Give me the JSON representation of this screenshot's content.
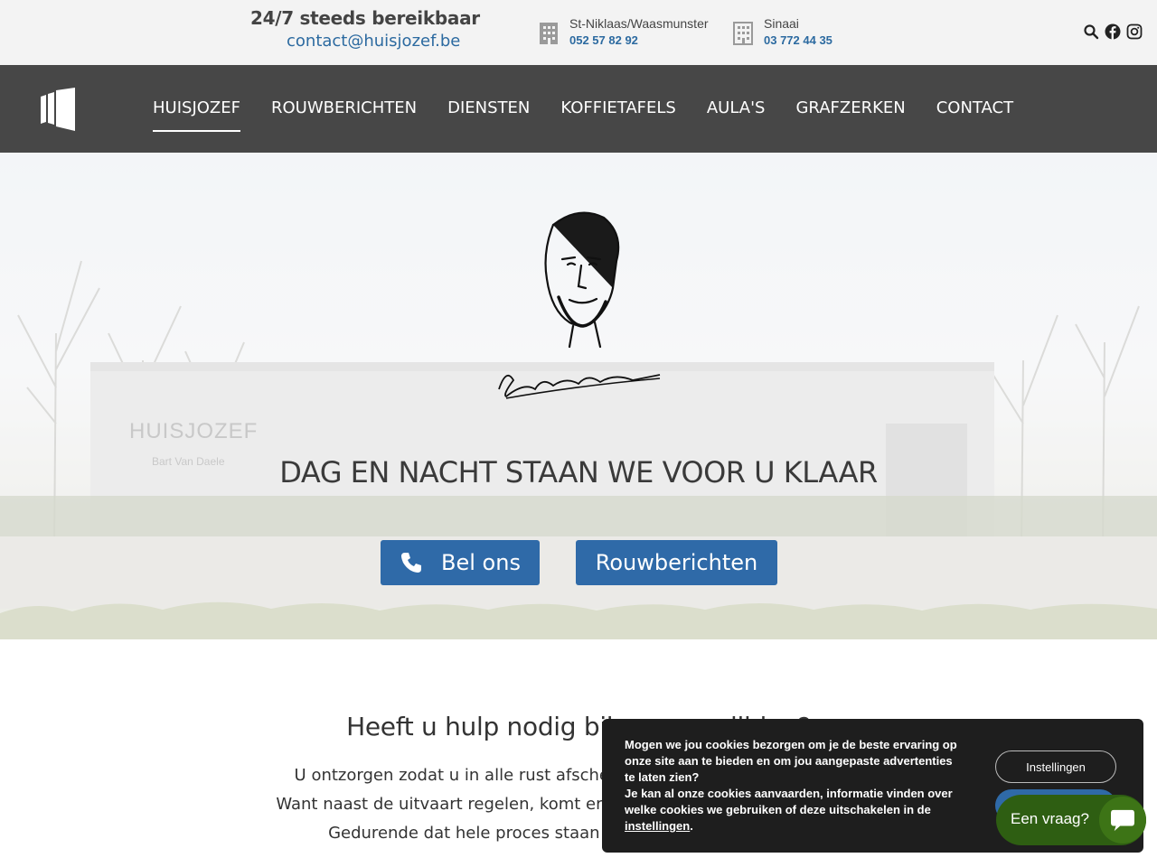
{
  "topbar": {
    "availability": "24/7 steeds bereikbaar",
    "email": "contact@huisjozef.be",
    "locations": [
      {
        "name": "St-Niklaas/Waasmunster",
        "phone": "052 57 82 92",
        "icon": "building-icon"
      },
      {
        "name": "Sinaai",
        "phone": "03 772 44 35",
        "icon": "building-icon"
      }
    ],
    "icons": [
      "search-icon",
      "facebook-icon",
      "instagram-icon"
    ]
  },
  "nav": {
    "logo": "huisjozef-logo",
    "items": [
      {
        "label": "HUISJOZEF",
        "active": true
      },
      {
        "label": "ROUWBERICHTEN",
        "active": false
      },
      {
        "label": "DIENSTEN",
        "active": false
      },
      {
        "label": "KOFFIETAFELS",
        "active": false
      },
      {
        "label": "AULA'S",
        "active": false
      },
      {
        "label": "GRAFZERKEN",
        "active": false
      },
      {
        "label": "CONTACT",
        "active": false
      }
    ]
  },
  "hero": {
    "background_signage_1": "HUISJOZEF",
    "background_signage_2": "Bart Van Daele",
    "portrait_signature": "Bart Van Daele",
    "title": "DAG EN NACHT STAAN WE VOOR U KLAAR",
    "buttons": {
      "call_label": "Bel ons",
      "call_icon": "phone-icon",
      "obituaries_label": "Rouwberichten"
    }
  },
  "content": {
    "title": "Heeft u hulp nodig bij een overlijden?",
    "lines": [
      "U ontzorgen zodat u in alle rust afscheid van uw dierbare kan nemen.",
      "Want naast de uitvaart regelen, komt er heel wat kijken bij een overlijden.",
      "Gedurende dat hele proces staan wij u bij: met raad en daad."
    ]
  },
  "cookie": {
    "text_1": "Mogen we jou cookies bezorgen om je de beste ervaring op onze site aan te bieden en om jou aangepaste advertenties te laten zien?",
    "text_2": "Je kan al onze cookies aanvaarden, informatie vinden over welke cookies we gebruiken of deze uitschakelen in de",
    "link": "instellingen",
    "text_end": ".",
    "settings_label": "Instellingen"
  },
  "chat": {
    "label": "Een vraag?",
    "icon": "chat-bubble-icon"
  },
  "colors": {
    "topbar_bg": "#f3f3f3",
    "nav_bg": "#474747",
    "accent_blue": "#2f6aa8",
    "link_blue": "#2c6aa0",
    "cookie_bg": "#1e1e1e",
    "chat_green": "#2e5e12"
  }
}
